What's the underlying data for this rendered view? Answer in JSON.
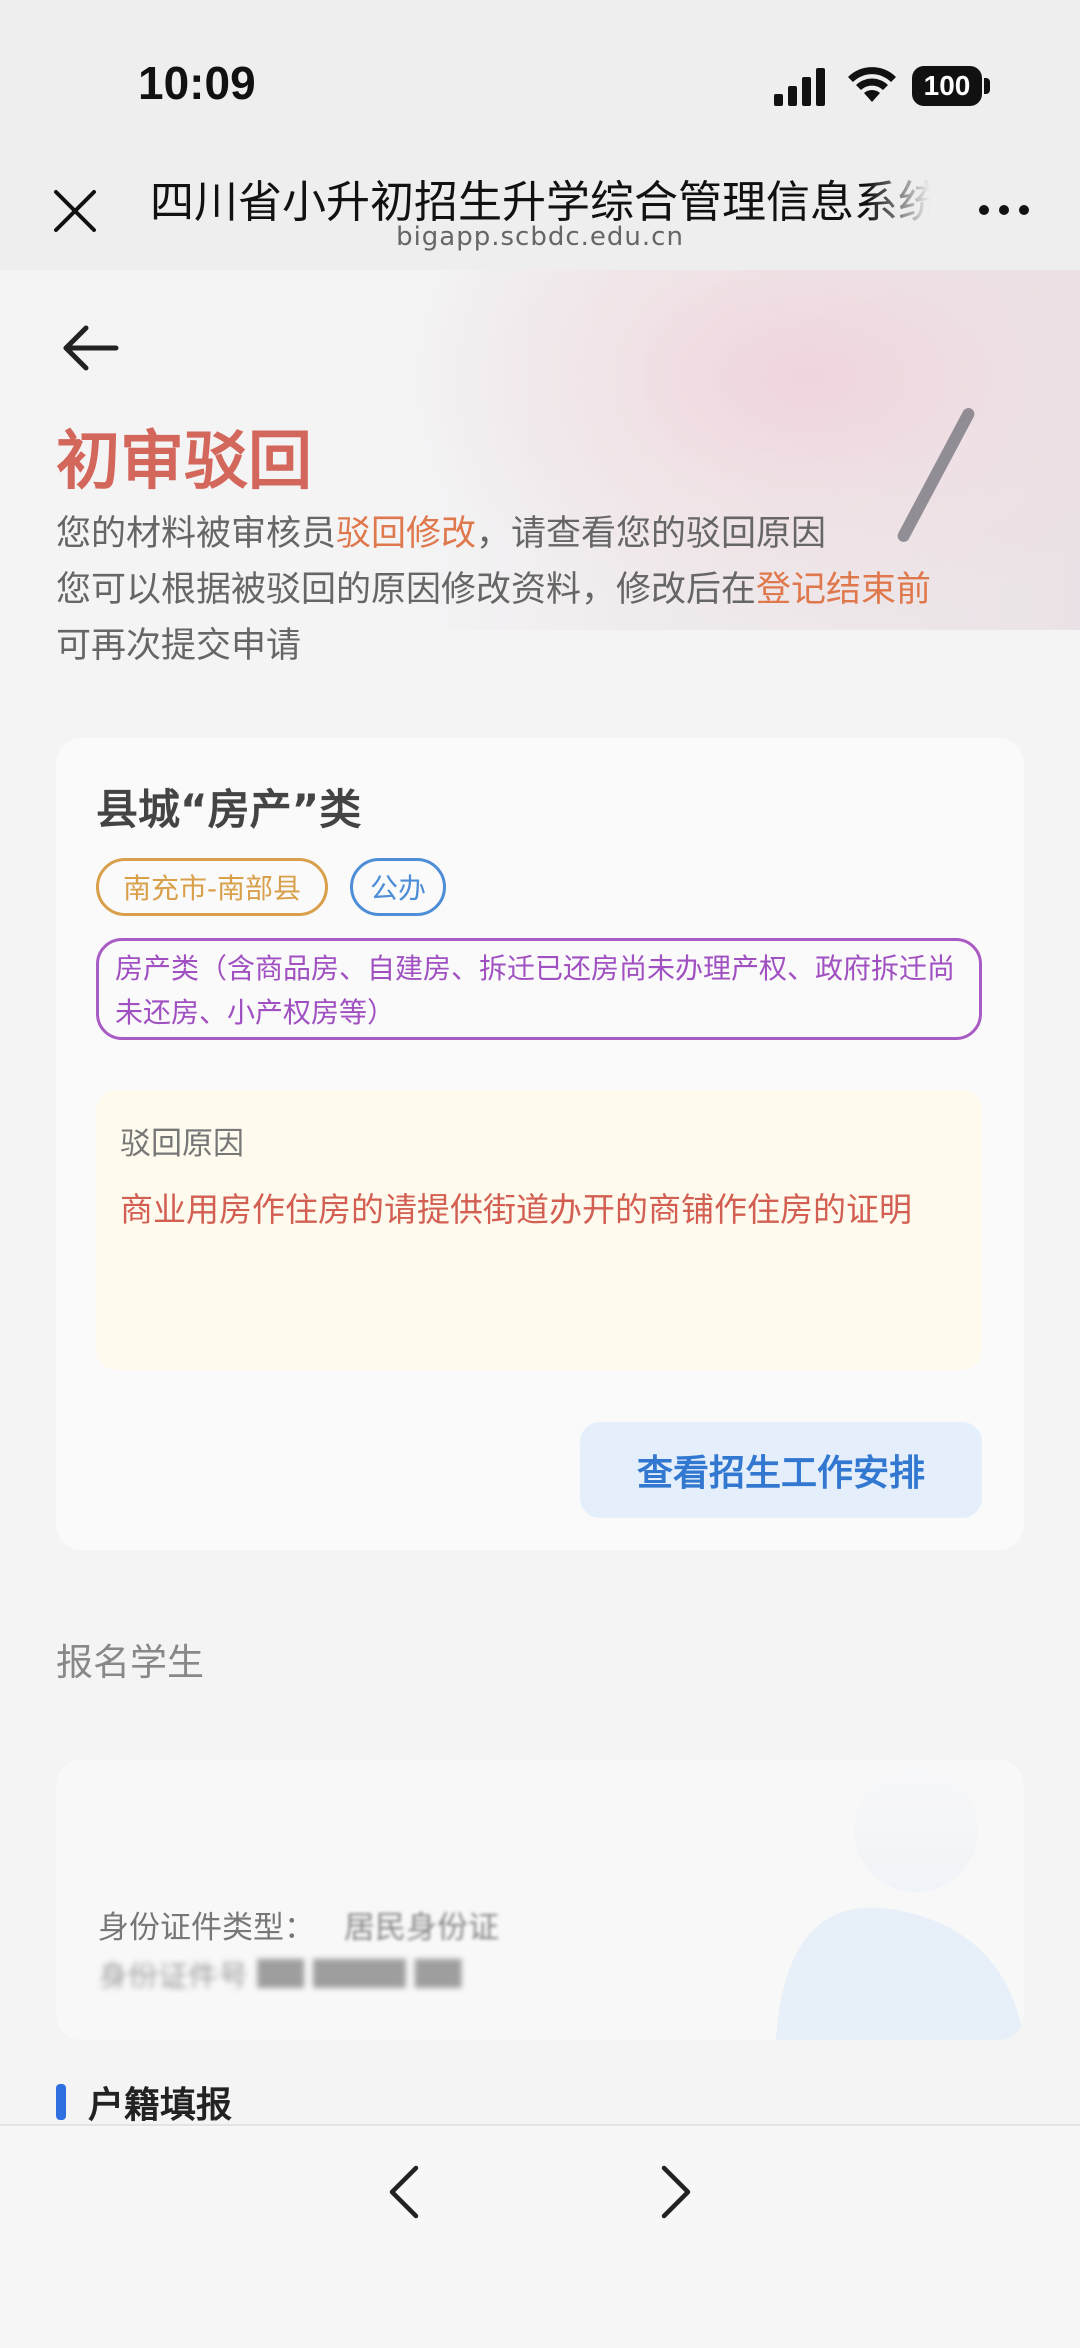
{
  "status_bar": {
    "time": "10:09",
    "battery": "100",
    "icons": [
      "signal-icon",
      "wifi-icon",
      "battery-icon"
    ]
  },
  "browser": {
    "title": "四川省小升初招生升学综合管理信息系统",
    "url": "bigapp.scbdc.edu.cn",
    "close_icon": "close-icon",
    "more_icon": "more-icon"
  },
  "header": {
    "back_icon": "arrow-left-icon",
    "title": "初审驳回",
    "desc_line1_prefix": "您的材料被审核员",
    "desc_line1_highlight": "驳回修改",
    "desc_line1_suffix": "，请查看您的驳回原因",
    "desc_line2_prefix": "您可以根据被驳回的原因修改资料，修改后在",
    "desc_line2_highlight": "登记结束前",
    "desc_line3": "可再次提交申请"
  },
  "card": {
    "title": "县城“房产”类",
    "tag_region": "南充市-南部县",
    "tag_type": "公办",
    "tag_category": "房产类（含商品房、自建房、拆迁已还房尚未办理产权、政府拆迁尚未还房、小产权房等）",
    "reason_label": "驳回原因",
    "reason_text": "商业用房作住房的请提供街道办开的商铺作住房的证明",
    "schedule_button": "查看招生工作安排"
  },
  "student": {
    "section_label": "报名学生",
    "id_type_label": "身份证件类型：",
    "id_type_value": "居民身份证",
    "id_number_placeholder": "身份证件号    ██ ████        ██"
  },
  "household": {
    "title": "户籍填报"
  },
  "bottom_bar": {
    "prev_icon": "chevron-left-icon",
    "next_icon": "chevron-right-icon"
  },
  "colors": {
    "accent_red": "#d4675c",
    "highlight_orange": "#e0784d",
    "tag_gold": "#d9a04b",
    "tag_blue": "#4d8ed6",
    "tag_purple": "#a95bc4",
    "button_blue": "#3277d0",
    "section_bar": "#2f6fe0"
  }
}
